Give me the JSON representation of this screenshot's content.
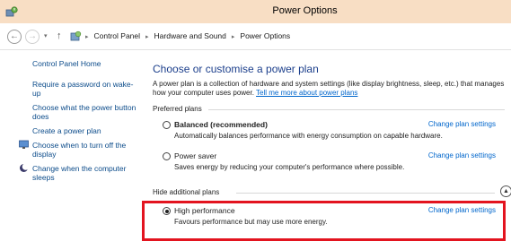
{
  "window": {
    "title": "Power Options"
  },
  "addressbar": {
    "back_icon": "←",
    "forward_icon": "→",
    "dropdown_icon": "▾",
    "up_icon": "↑",
    "crumbs": [
      "Control Panel",
      "Hardware and Sound",
      "Power Options"
    ],
    "separator": "▸"
  },
  "sidebar": {
    "items": [
      {
        "label": "Control Panel Home"
      },
      {
        "label": "Require a password on wake-up"
      },
      {
        "label": "Choose what the power button does"
      },
      {
        "label": "Create a power plan"
      },
      {
        "label": "Choose when to turn off the display",
        "icon": "display-icon"
      },
      {
        "label": "Change when the computer sleeps",
        "icon": "moon-icon"
      }
    ]
  },
  "main": {
    "title": "Choose or customise a power plan",
    "description": "A power plan is a collection of hardware and system settings (like display brightness, sleep, etc.) that manages how your computer uses power.",
    "description_link": "Tell me more about power plans",
    "preferred_header": "Preferred plans",
    "hidden_header": "Hide additional plans",
    "collapse_icon": "▲",
    "plans": [
      {
        "name": "Balanced (recommended)",
        "desc": "Automatically balances performance with energy consumption on capable hardware.",
        "link": "Change plan settings",
        "selected": false
      },
      {
        "name": "Power saver",
        "desc": "Saves energy by reducing your computer's performance where possible.",
        "link": "Change plan settings",
        "selected": false
      },
      {
        "name": "High performance",
        "desc": "Favours performance but may use more energy.",
        "link": "Change plan settings",
        "selected": true
      }
    ]
  },
  "colors": {
    "titlebar": "#f8dec4",
    "link": "#0066cc",
    "title": "#1c3f8c",
    "highlight": "#e3141f"
  }
}
